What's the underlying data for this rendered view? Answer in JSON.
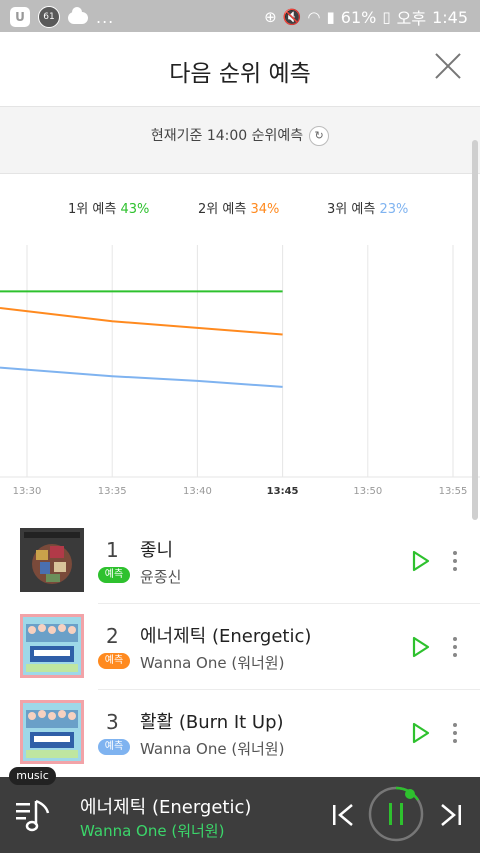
{
  "status_bar": {
    "notif_badge": "61",
    "dots": "...",
    "battery": "61%",
    "time_prefix": "오후",
    "time": "1:45"
  },
  "header": {
    "title": "다음 순위 예측"
  },
  "time_bar": {
    "text": "현재기준 14:00 순위예측"
  },
  "legend": [
    {
      "label": "1위 예측",
      "pct": "43%",
      "color": "#2ec12e"
    },
    {
      "label": "2위 예측",
      "pct": "34%",
      "color": "#ff8a1f"
    },
    {
      "label": "3위 예측",
      "pct": "23%",
      "color": "#7fb3f0"
    }
  ],
  "chart_data": {
    "type": "line",
    "x": [
      "13:30",
      "13:35",
      "13:40",
      "13:45",
      "13:50",
      "13:55"
    ],
    "current_tick": "13:45",
    "series": [
      {
        "name": "1위 예측",
        "color": "#2ec12e",
        "values": [
          43,
          43,
          43,
          43
        ]
      },
      {
        "name": "2위 예측",
        "color": "#ff8a1f",
        "values": [
          40.5,
          38.5,
          37.5,
          36.5
        ]
      },
      {
        "name": "3위 예측",
        "color": "#7fb3f0",
        "values": [
          31.5,
          30.2,
          29.5,
          28.6
        ]
      }
    ],
    "ylim": [
      15,
      50
    ],
    "grid": true
  },
  "rankings": [
    {
      "rank": "1",
      "badge": "예측",
      "badge_color": "#2ec12e",
      "title": "좋니",
      "artist": "윤종신"
    },
    {
      "rank": "2",
      "badge": "예측",
      "badge_color": "#ff8a1f",
      "title": "에너제틱 (Energetic)",
      "artist": "Wanna One (워너원)"
    },
    {
      "rank": "3",
      "badge": "예측",
      "badge_color": "#7fb3f0",
      "title": "활활 (Burn It Up)",
      "artist": "Wanna One (워너원)"
    }
  ],
  "player": {
    "tag": "music",
    "title": "에너제틱 (Energetic)",
    "artist": "Wanna One (워너원)"
  }
}
